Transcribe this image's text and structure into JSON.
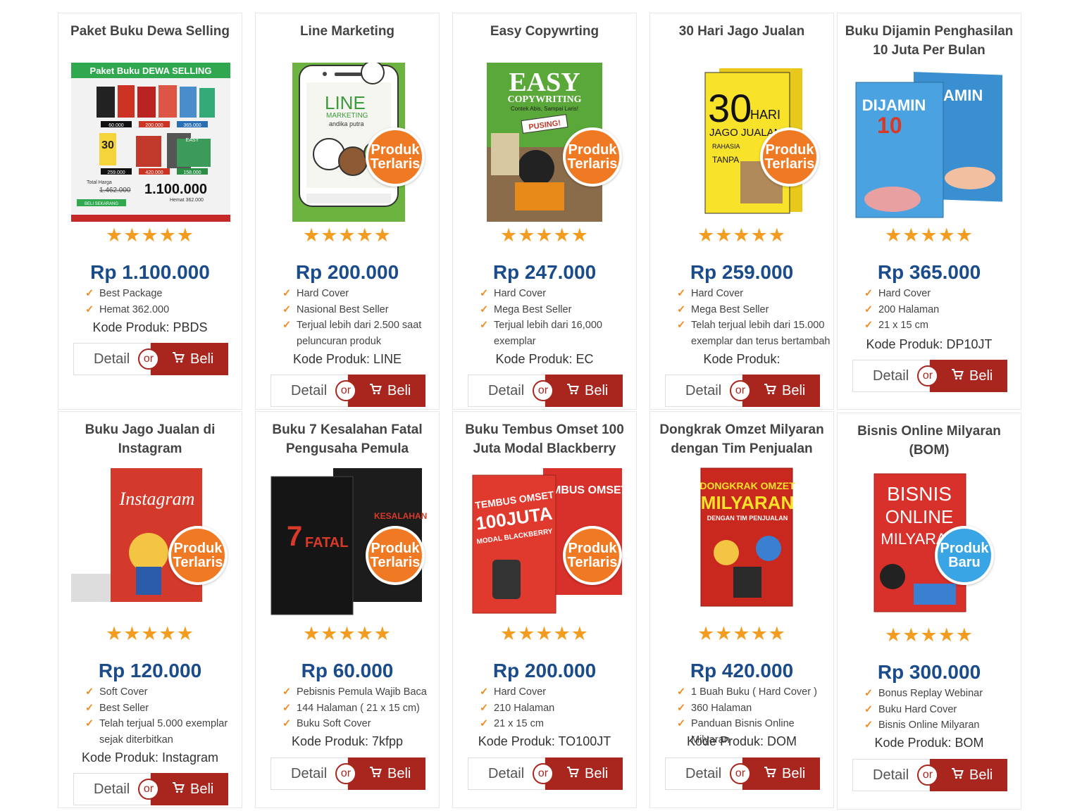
{
  "colors": {
    "price": "#1a4b8a",
    "buy_button": "#a8261d",
    "stars": "#f39c20",
    "badge_terlaris": "#f07a23",
    "badge_baru": "#3aa5e4"
  },
  "labels": {
    "detail": "Detail",
    "or": "or",
    "beli": "Beli",
    "stars": "★★★★★",
    "badge_terlaris_1": "Produk",
    "badge_terlaris_2": "Terlaris",
    "badge_baru_1": "Produk",
    "badge_baru_2": "Baru",
    "check": "✓",
    "rating": "5 of 5 stars"
  },
  "products": [
    {
      "title": "Paket Buku Dewa Selling",
      "price": "Rp 1.100.000",
      "features": [
        "Best Package",
        "Hemat 362.000"
      ],
      "kode": "Kode Produk: PBDS",
      "image": {
        "banner": "Paket Buku DEWA SELLING",
        "tags": [
          "60.000",
          "200.000",
          "365.000",
          "259.000",
          "420.000",
          "158.000"
        ],
        "total_label": "Total Harga",
        "old": "1.462.000",
        "new": "1.100.000",
        "hemat": "Hemat 362.000",
        "cta": "BELI SEKARANG",
        "easy": "EASY"
      }
    },
    {
      "title": "Line Marketing",
      "price": "Rp 200.000",
      "features": [
        "Hard Cover",
        "Nasional Best Seller",
        "Terjual lebih dari 2.500 saat peluncuran produk"
      ],
      "kode": "Kode Produk: LINE",
      "image": {
        "t1": "LINE",
        "t2": "MARKETING",
        "t3": "andika putra"
      },
      "badge": "terlaris"
    },
    {
      "title": "Easy Copywrting",
      "price": "Rp 247.000",
      "features": [
        "Hard Cover",
        "Mega Best Seller",
        "Terjual lebih dari 16,000 exemplar"
      ],
      "kode": "Kode Produk: EC",
      "image": {
        "t1": "EASY",
        "t2": "COPYWRITING",
        "t3": "Contek Abis, Sampai Laris!",
        "t4": "PUSING!"
      },
      "badge": "terlaris"
    },
    {
      "title": "30 Hari Jago Jualan",
      "price": "Rp 259.000",
      "features": [
        "Hard Cover",
        "Mega Best Seller",
        "Telah terjual lebih dari 15.000 exemplar dan terus bertambah"
      ],
      "kode": "Kode Produk:",
      "image": {
        "t1": "30",
        "t2": "HARI",
        "t3": "JAGO JUALAN",
        "t4": "RAHASIA",
        "t5": "TANPA"
      },
      "badge": "terlaris"
    },
    {
      "title": "Buku Dijamin Penghasilan 10 Juta Per Bulan",
      "price": "Rp 365.000",
      "features": [
        "Hard Cover",
        "200 Halaman",
        "21 x 15 cm"
      ],
      "kode": "Kode Produk: DP10JT",
      "image": {
        "t1": "DIJAMIN",
        "t2": "10",
        "t3": "JAMIN"
      }
    },
    {
      "title": "Buku Jago Jualan di Instagram",
      "price": "Rp 120.000",
      "features": [
        "Soft Cover",
        "Best Seller",
        "Telah terjual 5.000 exemplar sejak diterbitkan"
      ],
      "kode": "Kode Produk: Instagram",
      "image": {
        "t1": "Instagram"
      },
      "badge": "terlaris"
    },
    {
      "title": "Buku 7 Kesalahan Fatal Pengusaha Pemula",
      "price": "Rp 60.000",
      "features": [
        "Pebisnis Pemula Wajib Baca",
        "144 Halaman ( 21 x 15 cm)",
        "Buku Soft Cover"
      ],
      "kode": "Kode Produk: 7kfpp",
      "image": {
        "t1": "7",
        "t2": "FATAL",
        "t3": "KESALAHAN"
      },
      "badge": "terlaris"
    },
    {
      "title": "Buku Tembus Omset 100 Juta Modal Blackberry",
      "price": "Rp 200.000",
      "features": [
        "Hard Cover",
        "210 Halaman",
        "21 x 15 cm"
      ],
      "kode": "Kode Produk: TO100JT",
      "image": {
        "t1": "TEMBUS OMSET",
        "t2": "100JUTA",
        "t3": "MODAL BLACKBERRY"
      },
      "badge": "terlaris"
    },
    {
      "title": "Dongkrak Omzet Milyaran dengan Tim Penjualan",
      "price": "Rp 420.000",
      "features": [
        "1 Buah Buku ( Hard Cover )",
        "360 Halaman",
        "Panduan Bisnis Online Milyaran"
      ],
      "kode": "Kode Produk: DOM",
      "image": {
        "t1": "DONGKRAK OMZET",
        "t2": "MILYARAN",
        "t3": "DENGAN TIM PENJUALAN"
      }
    },
    {
      "title": "Bisnis Online Milyaran (BOM)",
      "price": "Rp 300.000",
      "features": [
        "Bonus Replay Webinar",
        "Buku Hard Cover",
        "Bisnis Online Milyaran"
      ],
      "kode": "Kode Produk: BOM",
      "image": {
        "t1": "BISNIS",
        "t2": "ONLINE",
        "t3": "MILYARAN"
      },
      "badge": "baru"
    }
  ]
}
